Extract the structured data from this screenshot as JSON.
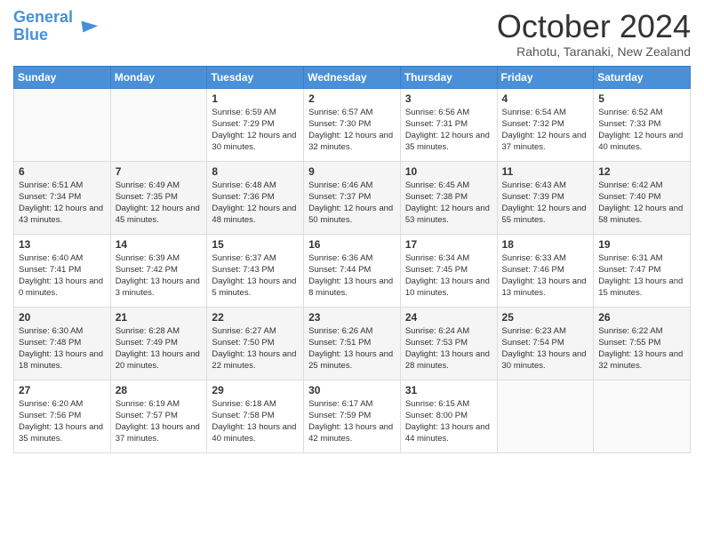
{
  "logo": {
    "text_general": "General",
    "text_blue": "Blue"
  },
  "header": {
    "month": "October 2024",
    "location": "Rahotu, Taranaki, New Zealand"
  },
  "weekdays": [
    "Sunday",
    "Monday",
    "Tuesday",
    "Wednesday",
    "Thursday",
    "Friday",
    "Saturday"
  ],
  "weeks": [
    [
      {
        "day": "",
        "sunrise": "",
        "sunset": "",
        "daylight": ""
      },
      {
        "day": "",
        "sunrise": "",
        "sunset": "",
        "daylight": ""
      },
      {
        "day": "1",
        "sunrise": "Sunrise: 6:59 AM",
        "sunset": "Sunset: 7:29 PM",
        "daylight": "Daylight: 12 hours and 30 minutes."
      },
      {
        "day": "2",
        "sunrise": "Sunrise: 6:57 AM",
        "sunset": "Sunset: 7:30 PM",
        "daylight": "Daylight: 12 hours and 32 minutes."
      },
      {
        "day": "3",
        "sunrise": "Sunrise: 6:56 AM",
        "sunset": "Sunset: 7:31 PM",
        "daylight": "Daylight: 12 hours and 35 minutes."
      },
      {
        "day": "4",
        "sunrise": "Sunrise: 6:54 AM",
        "sunset": "Sunset: 7:32 PM",
        "daylight": "Daylight: 12 hours and 37 minutes."
      },
      {
        "day": "5",
        "sunrise": "Sunrise: 6:52 AM",
        "sunset": "Sunset: 7:33 PM",
        "daylight": "Daylight: 12 hours and 40 minutes."
      }
    ],
    [
      {
        "day": "6",
        "sunrise": "Sunrise: 6:51 AM",
        "sunset": "Sunset: 7:34 PM",
        "daylight": "Daylight: 12 hours and 43 minutes."
      },
      {
        "day": "7",
        "sunrise": "Sunrise: 6:49 AM",
        "sunset": "Sunset: 7:35 PM",
        "daylight": "Daylight: 12 hours and 45 minutes."
      },
      {
        "day": "8",
        "sunrise": "Sunrise: 6:48 AM",
        "sunset": "Sunset: 7:36 PM",
        "daylight": "Daylight: 12 hours and 48 minutes."
      },
      {
        "day": "9",
        "sunrise": "Sunrise: 6:46 AM",
        "sunset": "Sunset: 7:37 PM",
        "daylight": "Daylight: 12 hours and 50 minutes."
      },
      {
        "day": "10",
        "sunrise": "Sunrise: 6:45 AM",
        "sunset": "Sunset: 7:38 PM",
        "daylight": "Daylight: 12 hours and 53 minutes."
      },
      {
        "day": "11",
        "sunrise": "Sunrise: 6:43 AM",
        "sunset": "Sunset: 7:39 PM",
        "daylight": "Daylight: 12 hours and 55 minutes."
      },
      {
        "day": "12",
        "sunrise": "Sunrise: 6:42 AM",
        "sunset": "Sunset: 7:40 PM",
        "daylight": "Daylight: 12 hours and 58 minutes."
      }
    ],
    [
      {
        "day": "13",
        "sunrise": "Sunrise: 6:40 AM",
        "sunset": "Sunset: 7:41 PM",
        "daylight": "Daylight: 13 hours and 0 minutes."
      },
      {
        "day": "14",
        "sunrise": "Sunrise: 6:39 AM",
        "sunset": "Sunset: 7:42 PM",
        "daylight": "Daylight: 13 hours and 3 minutes."
      },
      {
        "day": "15",
        "sunrise": "Sunrise: 6:37 AM",
        "sunset": "Sunset: 7:43 PM",
        "daylight": "Daylight: 13 hours and 5 minutes."
      },
      {
        "day": "16",
        "sunrise": "Sunrise: 6:36 AM",
        "sunset": "Sunset: 7:44 PM",
        "daylight": "Daylight: 13 hours and 8 minutes."
      },
      {
        "day": "17",
        "sunrise": "Sunrise: 6:34 AM",
        "sunset": "Sunset: 7:45 PM",
        "daylight": "Daylight: 13 hours and 10 minutes."
      },
      {
        "day": "18",
        "sunrise": "Sunrise: 6:33 AM",
        "sunset": "Sunset: 7:46 PM",
        "daylight": "Daylight: 13 hours and 13 minutes."
      },
      {
        "day": "19",
        "sunrise": "Sunrise: 6:31 AM",
        "sunset": "Sunset: 7:47 PM",
        "daylight": "Daylight: 13 hours and 15 minutes."
      }
    ],
    [
      {
        "day": "20",
        "sunrise": "Sunrise: 6:30 AM",
        "sunset": "Sunset: 7:48 PM",
        "daylight": "Daylight: 13 hours and 18 minutes."
      },
      {
        "day": "21",
        "sunrise": "Sunrise: 6:28 AM",
        "sunset": "Sunset: 7:49 PM",
        "daylight": "Daylight: 13 hours and 20 minutes."
      },
      {
        "day": "22",
        "sunrise": "Sunrise: 6:27 AM",
        "sunset": "Sunset: 7:50 PM",
        "daylight": "Daylight: 13 hours and 22 minutes."
      },
      {
        "day": "23",
        "sunrise": "Sunrise: 6:26 AM",
        "sunset": "Sunset: 7:51 PM",
        "daylight": "Daylight: 13 hours and 25 minutes."
      },
      {
        "day": "24",
        "sunrise": "Sunrise: 6:24 AM",
        "sunset": "Sunset: 7:53 PM",
        "daylight": "Daylight: 13 hours and 28 minutes."
      },
      {
        "day": "25",
        "sunrise": "Sunrise: 6:23 AM",
        "sunset": "Sunset: 7:54 PM",
        "daylight": "Daylight: 13 hours and 30 minutes."
      },
      {
        "day": "26",
        "sunrise": "Sunrise: 6:22 AM",
        "sunset": "Sunset: 7:55 PM",
        "daylight": "Daylight: 13 hours and 32 minutes."
      }
    ],
    [
      {
        "day": "27",
        "sunrise": "Sunrise: 6:20 AM",
        "sunset": "Sunset: 7:56 PM",
        "daylight": "Daylight: 13 hours and 35 minutes."
      },
      {
        "day": "28",
        "sunrise": "Sunrise: 6:19 AM",
        "sunset": "Sunset: 7:57 PM",
        "daylight": "Daylight: 13 hours and 37 minutes."
      },
      {
        "day": "29",
        "sunrise": "Sunrise: 6:18 AM",
        "sunset": "Sunset: 7:58 PM",
        "daylight": "Daylight: 13 hours and 40 minutes."
      },
      {
        "day": "30",
        "sunrise": "Sunrise: 6:17 AM",
        "sunset": "Sunset: 7:59 PM",
        "daylight": "Daylight: 13 hours and 42 minutes."
      },
      {
        "day": "31",
        "sunrise": "Sunrise: 6:15 AM",
        "sunset": "Sunset: 8:00 PM",
        "daylight": "Daylight: 13 hours and 44 minutes."
      },
      {
        "day": "",
        "sunrise": "",
        "sunset": "",
        "daylight": ""
      },
      {
        "day": "",
        "sunrise": "",
        "sunset": "",
        "daylight": ""
      }
    ]
  ]
}
